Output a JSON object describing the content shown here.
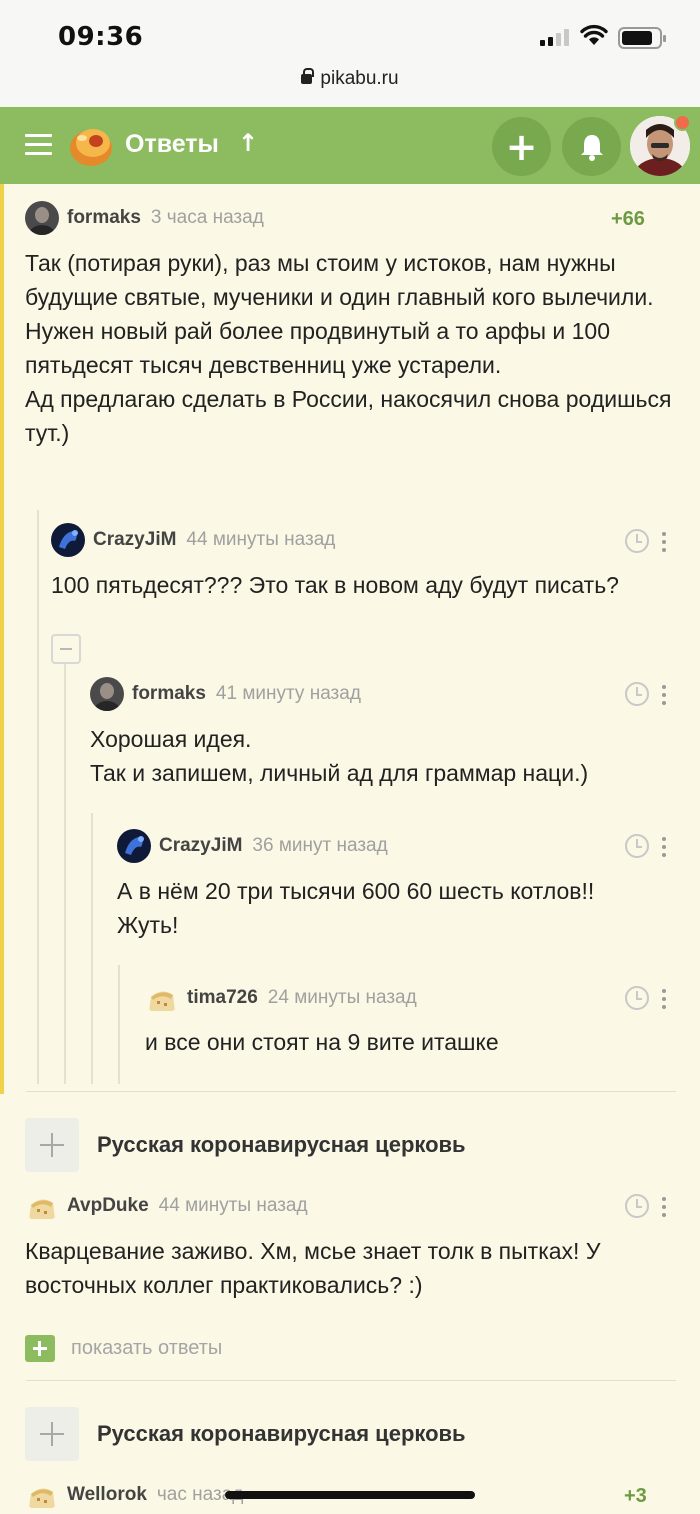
{
  "status_bar": {
    "time": "09:36",
    "url": "pikabu.ru"
  },
  "header": {
    "title": "Ответы",
    "title_arrow": "↑",
    "add_label": "+"
  },
  "comments": [
    {
      "user": "formaks",
      "time": "3 часа назад",
      "rating": "+66",
      "text": "Так (потирая руки), раз мы стоим у истоков, нам нужны будущие святые, мученики и один главный кого вылечили.\nНужен новый рай более продвинутый а то арфы и 100 пятьдесят тысяч девственниц уже устарели.\nАд предлагаю сделать в России, накосячил снова родишься тут.)"
    },
    {
      "user": "CrazyJiM",
      "time": "44 минуты назад",
      "text": "100 пятьдесят??? Это так в новом аду будут писать?"
    },
    {
      "user": "formaks",
      "time": "41 минуту назад",
      "text": "Хорошая идея.\nТак и запишем, личный ад для граммар наци.)"
    },
    {
      "user": "CrazyJiM",
      "time": "36 минут назад",
      "text": "А в нём 20 три тысячи 600 60 шесть котлов!!\nЖуть!"
    },
    {
      "user": "tima726",
      "time": "24 минуты назад",
      "text": "и все они стоят на 9 вите иташке"
    },
    {
      "user": "AvpDuke",
      "time": "44 минуты назад",
      "text": "Кварцевание заживо. Хм, мсье знает толк в пытках! У восточных коллег практиковались? :)"
    },
    {
      "user": "Wellorok",
      "time": "час назад",
      "rating": "+3"
    }
  ],
  "groups": [
    {
      "title": "Русская коронавирусная церковь"
    },
    {
      "title": "Русская коронавирусная церковь"
    }
  ],
  "show_replies_label": "показать ответы",
  "colors": {
    "header_green": "#8cbc5f",
    "page_bg": "#fbf8e5",
    "rating_green": "#6d9b44",
    "stripe_yellow": "#efd24a"
  }
}
